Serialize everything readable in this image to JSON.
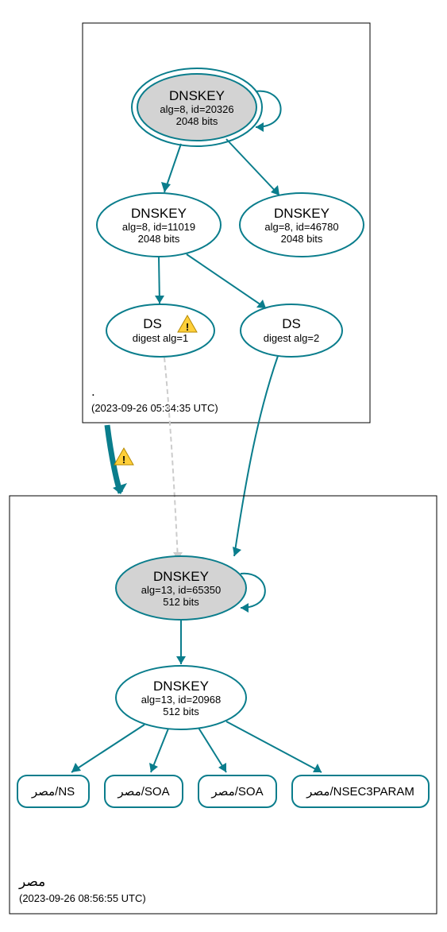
{
  "zones": {
    "root": {
      "label": ".",
      "timestamp": "(2023-09-26 05:34:35 UTC)"
    },
    "child": {
      "label": "مصر",
      "timestamp": "(2023-09-26 08:56:55 UTC)"
    }
  },
  "nodes": {
    "ksk_root": {
      "title": "DNSKEY",
      "line2": "alg=8, id=20326",
      "line3": "2048 bits"
    },
    "zsk_root1": {
      "title": "DNSKEY",
      "line2": "alg=8, id=11019",
      "line3": "2048 bits"
    },
    "zsk_root2": {
      "title": "DNSKEY",
      "line2": "alg=8, id=46780",
      "line3": "2048 bits"
    },
    "ds1": {
      "title": "DS",
      "line2": "digest alg=1"
    },
    "ds2": {
      "title": "DS",
      "line2": "digest alg=2"
    },
    "ksk_child": {
      "title": "DNSKEY",
      "line2": "alg=13, id=65350",
      "line3": "512 bits"
    },
    "zsk_child": {
      "title": "DNSKEY",
      "line2": "alg=13, id=20968",
      "line3": "512 bits"
    },
    "rr_ns": {
      "label": "مصر/NS"
    },
    "rr_soa1": {
      "label": "مصر/SOA"
    },
    "rr_soa2": {
      "label": "مصر/SOA"
    },
    "rr_nsec3": {
      "label": "مصر/NSEC3PARAM"
    }
  },
  "colors": {
    "stroke": "#0a7d8c",
    "fill_sep": "#d3d3d3",
    "warn": "#ffcf3a"
  }
}
